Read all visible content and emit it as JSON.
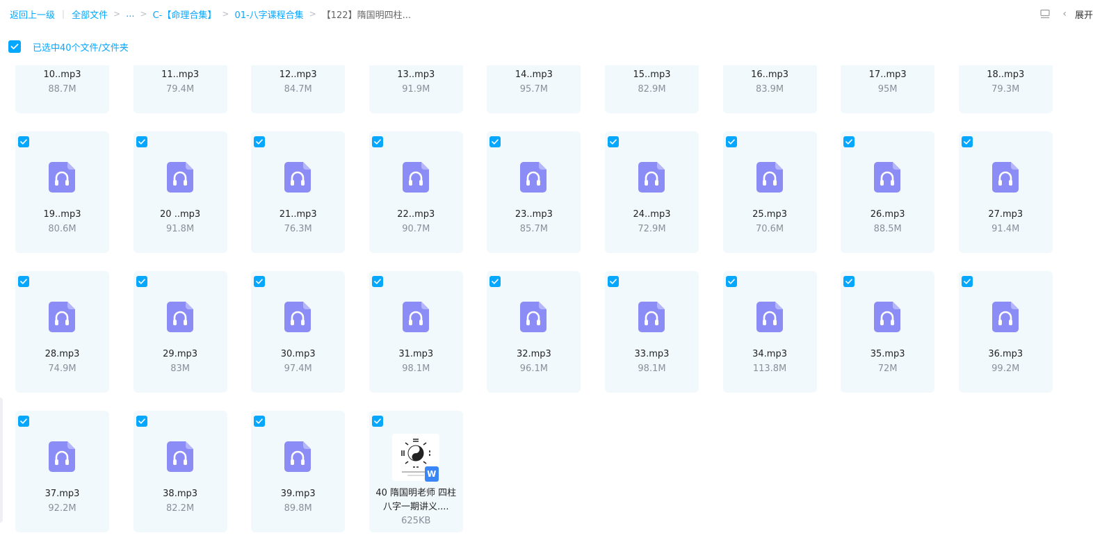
{
  "breadcrumb": {
    "back": "返回上一级",
    "root": "全部文件",
    "ellipsis": "...",
    "level1": "C-【命理合集】",
    "level2": "01-八字课程合集",
    "current": "【122】隋国明四柱..."
  },
  "top_right": {
    "expand_label": "展开"
  },
  "selection": {
    "text": "已选中40个文件/文件夹"
  },
  "colors": {
    "accent": "#06a7ff",
    "card_bg": "#f2f9fd",
    "audio_icon": "#8b8cf5"
  },
  "files": [
    {
      "name": "10..mp3",
      "size": "88.7M",
      "type": "audio"
    },
    {
      "name": "11..mp3",
      "size": "79.4M",
      "type": "audio"
    },
    {
      "name": "12..mp3",
      "size": "84.7M",
      "type": "audio"
    },
    {
      "name": "13..mp3",
      "size": "91.9M",
      "type": "audio"
    },
    {
      "name": "14..mp3",
      "size": "95.7M",
      "type": "audio"
    },
    {
      "name": "15..mp3",
      "size": "82.9M",
      "type": "audio"
    },
    {
      "name": "16..mp3",
      "size": "83.9M",
      "type": "audio"
    },
    {
      "name": "17..mp3",
      "size": "95M",
      "type": "audio"
    },
    {
      "name": "18..mp3",
      "size": "79.3M",
      "type": "audio"
    },
    {
      "name": "19..mp3",
      "size": "80.6M",
      "type": "audio"
    },
    {
      "name": "20 ..mp3",
      "size": "91.8M",
      "type": "audio"
    },
    {
      "name": "21..mp3",
      "size": "76.3M",
      "type": "audio"
    },
    {
      "name": "22..mp3",
      "size": "90.7M",
      "type": "audio"
    },
    {
      "name": "23..mp3",
      "size": "85.7M",
      "type": "audio"
    },
    {
      "name": "24..mp3",
      "size": "72.9M",
      "type": "audio"
    },
    {
      "name": "25.mp3",
      "size": "70.6M",
      "type": "audio"
    },
    {
      "name": "26.mp3",
      "size": "88.5M",
      "type": "audio"
    },
    {
      "name": "27.mp3",
      "size": "91.4M",
      "type": "audio"
    },
    {
      "name": "28.mp3",
      "size": "74.9M",
      "type": "audio"
    },
    {
      "name": "29.mp3",
      "size": "83M",
      "type": "audio"
    },
    {
      "name": "30.mp3",
      "size": "97.4M",
      "type": "audio"
    },
    {
      "name": "31.mp3",
      "size": "98.1M",
      "type": "audio"
    },
    {
      "name": "32.mp3",
      "size": "96.1M",
      "type": "audio"
    },
    {
      "name": "33.mp3",
      "size": "98.1M",
      "type": "audio"
    },
    {
      "name": "34.mp3",
      "size": "113.8M",
      "type": "audio"
    },
    {
      "name": "35.mp3",
      "size": "72M",
      "type": "audio"
    },
    {
      "name": "36.mp3",
      "size": "99.2M",
      "type": "audio"
    },
    {
      "name": "37.mp3",
      "size": "92.2M",
      "type": "audio"
    },
    {
      "name": "38.mp3",
      "size": "82.2M",
      "type": "audio"
    },
    {
      "name": "39.mp3",
      "size": "89.8M",
      "type": "audio"
    },
    {
      "name": "40 隋国明老师 四柱八字一期讲义....",
      "size": "625KB",
      "type": "doc",
      "badge": "W"
    }
  ]
}
